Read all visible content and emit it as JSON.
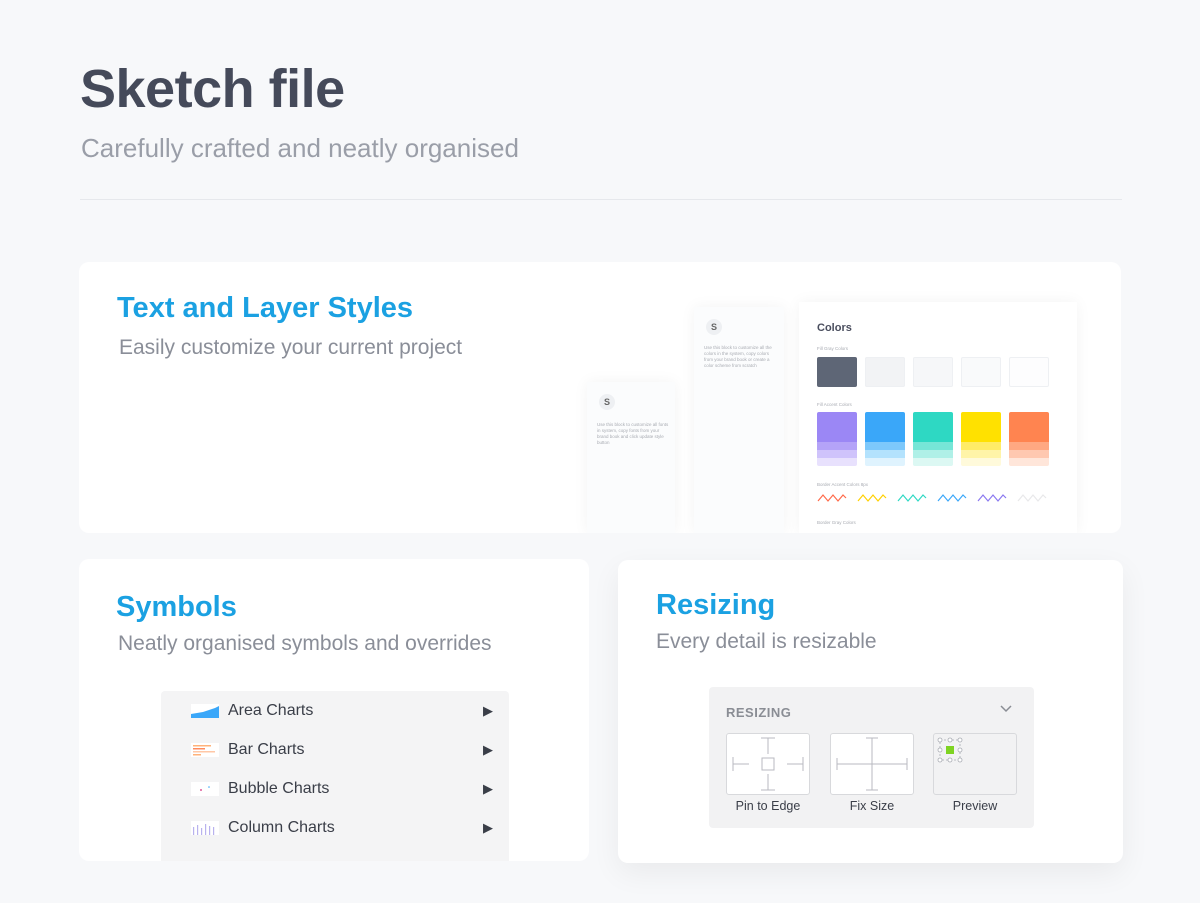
{
  "header": {
    "title": "Sketch file",
    "subtitle": "Carefully crafted and neatly organised"
  },
  "card_styles": {
    "title": "Text and Layer Styles",
    "subtitle": "Easily customize your current project",
    "preview": {
      "panel_a_text": "Use this block to customize all fonts in system, copy fonts from your brand book and click update style button",
      "panel_b_text": "Use this block to customize all the colors in the system, copy colors from your brand book or create a color scheme from scratch",
      "colors_title": "Colors",
      "fill_gray_label": "Fill Gray Colors",
      "fill_accent_label": "Fill Accent Colors",
      "border_accent_label": "Border Accent Colors 8px",
      "border_gray_label": "Border Gray Colors",
      "gray_swatches": [
        "#5e6676",
        "#f2f3f5",
        "#f6f7f9",
        "#f9fafb",
        "#fdfdfe"
      ],
      "accent_swatches": [
        [
          "#9b87f5",
          "#b4a3f8",
          "#cfc3fb",
          "#e8e1fd"
        ],
        [
          "#3aa7f9",
          "#7dc8fb",
          "#b3e2fd",
          "#dff3fe"
        ],
        [
          "#2ed8c3",
          "#76e6d7",
          "#aff0e7",
          "#dcf8f3"
        ],
        [
          "#ffe100",
          "#ffec66",
          "#fff4a8",
          "#fffadb"
        ],
        [
          "#ff8450",
          "#ffa882",
          "#ffc8b0",
          "#ffe6da"
        ]
      ],
      "wave_colors": [
        "#ff6a4a",
        "#ffd000",
        "#2ed8c3",
        "#3aa7f9",
        "#8a78f0",
        "#e8e8ea"
      ]
    }
  },
  "card_symbols": {
    "title": "Symbols",
    "subtitle": "Neatly organised symbols and overrides",
    "items": [
      {
        "label": "Area Charts",
        "thumb": "area-chart-icon"
      },
      {
        "label": "Bar Charts",
        "thumb": "bar-chart-icon"
      },
      {
        "label": "Bubble Charts",
        "thumb": "bubble-chart-icon"
      },
      {
        "label": "Column Charts",
        "thumb": "column-chart-icon"
      }
    ],
    "arrow": "▶"
  },
  "card_resizing": {
    "title": "Resizing",
    "subtitle": "Every detail is resizable",
    "panel_title": "RESIZING",
    "options": [
      "Pin to Edge",
      "Fix Size",
      "Preview"
    ],
    "preview_accent": "#7ed321"
  }
}
